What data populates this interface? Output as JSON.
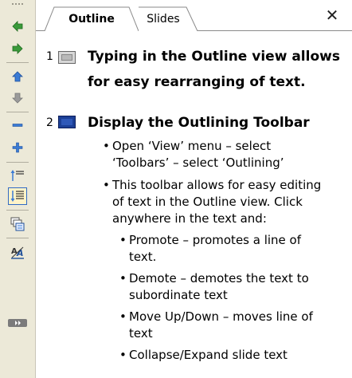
{
  "panel": {
    "close_glyph": "✕"
  },
  "tabs": [
    {
      "label": "Outline",
      "active": true
    },
    {
      "label": "Slides",
      "active": false
    }
  ],
  "toolbar": {
    "buttons": [
      {
        "name": "promote-icon"
      },
      {
        "name": "demote-icon"
      },
      {
        "name": "move-up-icon"
      },
      {
        "name": "move-down-icon"
      },
      {
        "name": "collapse-icon"
      },
      {
        "name": "expand-icon"
      },
      {
        "name": "collapse-all-icon"
      },
      {
        "name": "expand-all-icon"
      },
      {
        "name": "summary-slide-icon"
      },
      {
        "name": "show-formatting-icon"
      },
      {
        "name": "toolbar-options-icon"
      }
    ]
  },
  "outline": {
    "slides": [
      {
        "number": "1",
        "title_lines": [
          "Typing in the Outline view allows",
          "for easy rearranging of text."
        ]
      },
      {
        "number": "2",
        "title_lines": [
          "Display the Outlining Toolbar"
        ],
        "bullets": [
          {
            "lines": [
              "Open ‘View’ menu – select",
              "‘Toolbars’ – select ‘Outlining’"
            ]
          },
          {
            "lines": [
              "This toolbar allows for easy editing",
              "of text in the Outline view.  Click",
              "anywhere in the text and:"
            ]
          },
          {
            "lines": [
              "Promote – promotes a line of",
              "text."
            ]
          },
          {
            "lines": [
              "Demote – demotes the text to",
              "subordinate text"
            ]
          },
          {
            "lines": [
              "Move Up/Down – moves line of",
              "text"
            ]
          },
          {
            "lines": [
              "Collapse/Expand slide text"
            ]
          }
        ]
      }
    ]
  },
  "colors": {
    "toolbar_bg": "#ece9d8",
    "arrow_green": "#3a9a3a",
    "arrow_blue": "#3a7bd5",
    "selected_slide_icon": "#1c3f95"
  }
}
